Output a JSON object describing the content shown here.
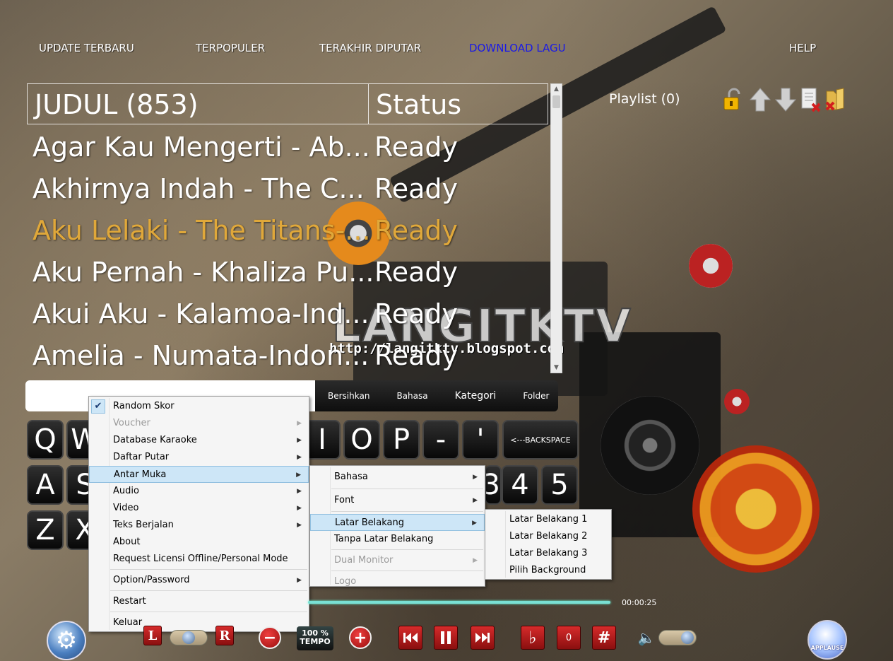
{
  "nav": {
    "update": "UPDATE TERBARU",
    "popular": "TERPOPULER",
    "recent": "TERAKHIR DIPUTAR",
    "download": "DOWNLOAD LAGU",
    "help": "HELP"
  },
  "watermark": {
    "logo": "LANGITKTV",
    "url": "http://langitktv.blogspot.com"
  },
  "table": {
    "header_title": "JUDUL (853)",
    "header_status": "Status",
    "rows": [
      {
        "title": "Agar Kau Mengerti - Ab...",
        "status": "Ready"
      },
      {
        "title": "Akhirnya Indah - The C...",
        "status": "Ready"
      },
      {
        "title": "Aku Lelaki - The Titans-...",
        "status": "Ready"
      },
      {
        "title": "Aku Pernah - Khaliza Pu...",
        "status": "Ready"
      },
      {
        "title": "Akui Aku - Kalamoa-Ind...",
        "status": "Ready"
      },
      {
        "title": "Amelia - Numata-Indon...",
        "status": "Ready"
      }
    ],
    "highlight_color": "#e0a83a"
  },
  "playlist": {
    "label": "Playlist (0)"
  },
  "category_bar": {
    "clear": "Bersihkan",
    "language": "Bahasa",
    "category": "Kategori",
    "folder": "Folder"
  },
  "keyboard": {
    "row1": [
      "Q",
      "W",
      "I",
      "O",
      "P",
      "-",
      "'"
    ],
    "backspace": "<---BACKSPACE",
    "row2": [
      "A",
      "S",
      "3",
      "4",
      "5"
    ],
    "row3": [
      "Z",
      "X"
    ]
  },
  "main_menu": {
    "items": [
      {
        "label": "Random Skor"
      },
      {
        "label": "Voucher"
      },
      {
        "label": "Database Karaoke"
      },
      {
        "label": "Daftar Putar"
      },
      {
        "label": "Antar Muka"
      },
      {
        "label": "Audio"
      },
      {
        "label": "Video"
      },
      {
        "label": "Teks Berjalan"
      },
      {
        "label": "About"
      },
      {
        "label": "Request Licensi Offline/Personal Mode"
      },
      {
        "label": "Option/Password"
      },
      {
        "label": "Restart"
      },
      {
        "label": "Keluar"
      }
    ]
  },
  "sub_menu": {
    "items": [
      {
        "label": "Bahasa"
      },
      {
        "label": "Font"
      },
      {
        "label": "Latar Belakang"
      },
      {
        "label": "Tanpa Latar Belakang"
      },
      {
        "label": "Dual Monitor"
      },
      {
        "label": "Logo"
      }
    ]
  },
  "sub_sub_menu": {
    "items": [
      {
        "label": "Latar Belakang 1"
      },
      {
        "label": "Latar Belakang 2"
      },
      {
        "label": "Latar Belakang 3"
      },
      {
        "label": "Pilih Background"
      }
    ]
  },
  "controls": {
    "left_label": "L",
    "right_label": "R",
    "tempo_percent": "100 %",
    "tempo_label": "TEMPO",
    "time": "00:00:25",
    "key_value": "0",
    "flat": "♭",
    "sharp": "#",
    "applause": "APPLAUSE",
    "progress_fraction": 1.0
  },
  "colors": {
    "accent_blue": "#1a1ae6",
    "menu_highlight": "#cde6f7",
    "control_red": "#d62b2b"
  },
  "icons": [
    "lock-icon",
    "arrow-up-icon",
    "arrow-down-icon",
    "delete-list-icon",
    "delete-folder-icon",
    "gear-icon",
    "volume-icon"
  ]
}
